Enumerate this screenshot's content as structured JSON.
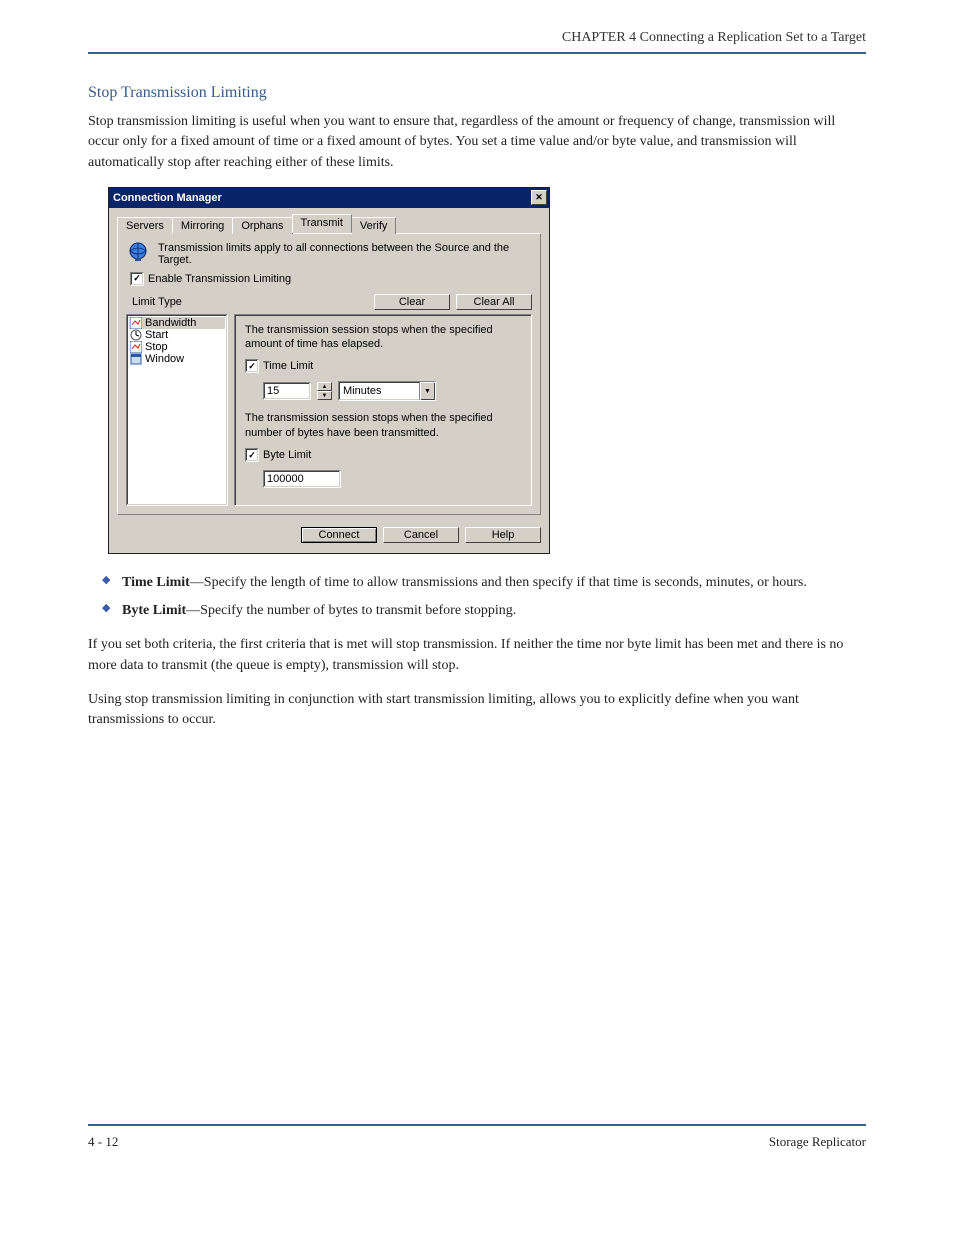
{
  "page": {
    "chapter": "CHAPTER 4 Connecting a Replication Set to a Target",
    "section_heading": "Stop Transmission Limiting",
    "intro": "Stop transmission limiting is useful when you want to ensure that, regardless of the amount or frequency of change, transmission will occur only for a fixed amount of time or a fixed amount of bytes. You set a time value and/or byte value, and transmission will automatically stop after reaching either of these limits.",
    "bullet_time_label": "Time Limit",
    "bullet_time_text": "—Specify the length of time to allow transmissions and then specify if that time is seconds, minutes, or hours.",
    "bullet_byte_label": "Byte Limit",
    "bullet_byte_text": "—Specify the number of bytes to transmit before stopping.",
    "post_text": "If you set both criteria, the first criteria that is met will stop transmission. If neither the time nor byte limit has been met and there is no more data to transmit (the queue is empty), transmission will stop.",
    "post_text2": "Using stop transmission limiting in conjunction with start transmission limiting, allows you to explicitly define when you want transmissions to occur.",
    "footer_left": "4 - 12",
    "footer_right": "Storage Replicator"
  },
  "dialog": {
    "title": "Connection Manager",
    "tabs": [
      "Servers",
      "Mirroring",
      "Orphans",
      "Transmit",
      "Verify"
    ],
    "active_tab_index": 3,
    "info_text": "Transmission limits apply to all connections between the Source and the Target.",
    "enable_checkbox_label": "Enable Transmission Limiting",
    "enable_checked": true,
    "limit_type_label": "Limit Type",
    "clear_btn": "Clear",
    "clear_all_btn": "Clear All",
    "list_items": [
      {
        "label": "Bandwidth",
        "icon": "chart"
      },
      {
        "label": "Start",
        "icon": "clock"
      },
      {
        "label": "Stop",
        "icon": "chart"
      },
      {
        "label": "Window",
        "icon": "window"
      }
    ],
    "panel": {
      "time_desc": "The transmission session stops when the specified amount of time has elapsed.",
      "time_limit_label": "Time Limit",
      "time_limit_checked": true,
      "time_value": "15",
      "time_unit": "Minutes",
      "byte_desc": "The transmission session stops when the specified number of bytes have been transmitted.",
      "byte_limit_label": "Byte Limit",
      "byte_limit_checked": true,
      "byte_value": "100000"
    },
    "buttons": {
      "connect": "Connect",
      "cancel": "Cancel",
      "help": "Help"
    }
  }
}
